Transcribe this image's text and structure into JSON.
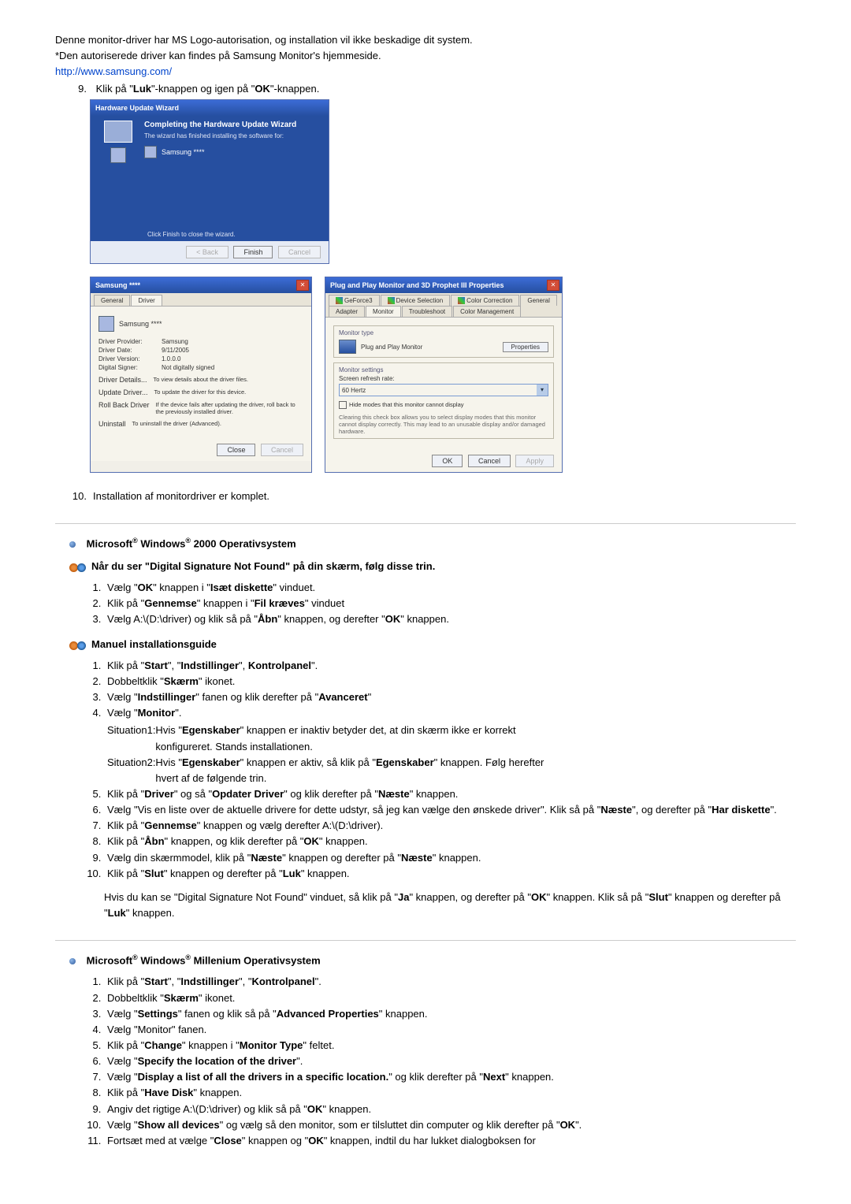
{
  "intro": {
    "line1": "Denne monitor-driver har MS Logo-autorisation, og installation vil ikke beskadige dit system.",
    "line2": "*Den autoriserede driver kan findes på Samsung Monitor's hjemmeside.",
    "link": "http://www.samsung.com/",
    "step9_prefix": "Klik på \"",
    "step9_b1": "Luk",
    "step9_mid": "\"-knappen og igen på \"",
    "step9_b2": "OK",
    "step9_suffix": "\"-knappen.",
    "step10": "Installation af monitordriver er komplet."
  },
  "wiz": {
    "title": "Hardware Update Wizard",
    "heading": "Completing the Hardware Update Wizard",
    "sub": "The wizard has finished installing the software for:",
    "device": "Samsung ****",
    "note": "Click Finish to close the wizard.",
    "back": "< Back",
    "finish": "Finish",
    "cancel": "Cancel"
  },
  "driverProps": {
    "title": "Samsung ****",
    "tabGeneral": "General",
    "tabDriver": "Driver",
    "device": "Samsung ****",
    "provider_k": "Driver Provider:",
    "provider_v": "Samsung",
    "date_k": "Driver Date:",
    "date_v": "9/11/2005",
    "version_k": "Driver Version:",
    "version_v": "1.0.0.0",
    "signer_k": "Digital Signer:",
    "signer_v": "Not digitally signed",
    "btn_details": "Driver Details...",
    "desc_details": "To view details about the driver files.",
    "btn_update": "Update Driver...",
    "desc_update": "To update the driver for this device.",
    "btn_rollback": "Roll Back Driver",
    "desc_rollback": "If the device fails after updating the driver, roll back to the previously installed driver.",
    "btn_uninstall": "Uninstall",
    "desc_uninstall": "To uninstall the driver (Advanced).",
    "close": "Close",
    "cancel2": "Cancel"
  },
  "displayProps": {
    "title": "Plug and Play Monitor and 3D Prophet III Properties",
    "tabs_row1": [
      "Color Correction"
    ],
    "tabs_row2": [
      "General",
      "Adapter",
      "Monitor",
      "Troubleshoot",
      "Color Management"
    ],
    "extra_tabs": [
      "GeForce3",
      "Device Selection"
    ],
    "monitorType": "Monitor type",
    "monitorName": "Plug and Play Monitor",
    "propsBtn": "Properties",
    "monitorSettings": "Monitor settings",
    "refresh_label": "Screen refresh rate:",
    "refresh_value": "60 Hertz",
    "hide_label": "Hide modes that this monitor cannot display",
    "hide_note": "Clearing this check box allows you to select display modes that this monitor cannot display correctly. This may lead to an unusable display and/or damaged hardware.",
    "ok": "OK",
    "cancel": "Cancel",
    "apply": "Apply"
  },
  "section2000": {
    "title_pre": "Microsoft",
    "title_mid": " Windows",
    "title_post": " 2000 Operativsystem",
    "sub1": "Når du ser \"Digital Signature Not Found\" på din skærm, følg disse trin.",
    "s1a": "Vælg \"OK\" knappen i \"Isæt diskette\" vinduet.",
    "s1b": "Klik på \"Gennemse\" knappen i \"Fil kræves\" vinduet",
    "s1c": "Vælg A:\\(D:\\driver) og klik så på \"Åbn\" knappen, og derefter \"OK\" knappen.",
    "sub2": "Manuel installationsguide",
    "m1": "Klik på \"Start\", \"Indstillinger\", Kontrolpanel\".",
    "m2": "Dobbeltklik \"Skærm\" ikonet.",
    "m3": "Vælg \"Indstillinger\" fanen og klik derefter på \"Avanceret\"",
    "m4": "Vælg \"Monitor\".",
    "sit1": "Situation1:Hvis \"Egenskaber\" knappen er inaktiv betyder det, at din skærm ikke er korrekt konfigureret. Stands installationen.",
    "sit2": "Situation2:Hvis \"Egenskaber\" knappen er aktiv, så klik på \"Egenskaber\" knappen. Følg herefter hvert af de følgende trin.",
    "m5": "Klik på \"Driver\" og så \"Opdater Driver\" og klik derefter på \"Næste\" knappen.",
    "m6": "Vælg \"Vis en liste over de aktuelle drivere for dette udstyr, så jeg kan vælge den ønskede driver\". Klik så på \"Næste\", og derefter på \"Har diskette\".",
    "m7": "Klik på \"Gennemse\" knappen og vælg derefter A:\\(D:\\driver).",
    "m8": "Klik på \"Åbn\" knappen, og klik derefter på \"OK\" knappen.",
    "m9": "Vælg din skærmmodel, klik på \"Næste\" knappen og derefter på \"Næste\" knappen.",
    "m10": "Klik på \"Slut\" knappen og derefter på \"Luk\" knappen.",
    "note": "Hvis du kan se \"Digital Signature Not Found\" vinduet, så klik på \"Ja\" knappen, og derefter på \"OK\" knappen. Klik så på \"Slut\" knappen og derefter på \"Luk\" knappen."
  },
  "sectionME": {
    "title_pre": "Microsoft",
    "title_mid": " Windows",
    "title_post": " Millenium Operativsystem",
    "m1": "Klik på \"Start\", \"Indstillinger\", \"Kontrolpanel\".",
    "m2": "Dobbeltklik \"Skærm\" ikonet.",
    "m3": "Vælg \"Settings\" fanen og klik så på \"Advanced Properties\" knappen.",
    "m4": "Vælg \"Monitor\" fanen.",
    "m5": "Klik på \"Change\" knappen i \"Monitor Type\" feltet.",
    "m6": "Vælg \"Specify the location of the driver\".",
    "m7": "Vælg \"Display a list of all the drivers in a specific location.\" og klik derefter på \"Next\" knappen.",
    "m8": "Klik på \"Have Disk\" knappen.",
    "m9": "Angiv det rigtige A:\\(D:\\driver) og klik så på \"OK\" knappen.",
    "m10": "Vælg \"Show all devices\" og vælg så den monitor, som er tilsluttet din computer og klik derefter på \"OK\".",
    "m11": "Fortsæt med at vælge \"Close\" knappen og \"OK\" knappen, indtil du har lukket dialogboksen for"
  }
}
